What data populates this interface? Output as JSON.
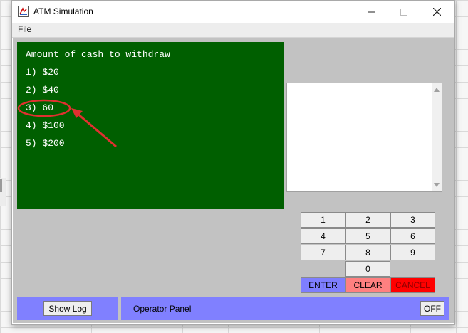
{
  "window": {
    "title": "ATM Simulation",
    "icon": "java-app-icon"
  },
  "window_controls": [
    "minimize-icon",
    "maximize-icon",
    "close-icon"
  ],
  "menu": {
    "file": "File"
  },
  "screen": {
    "lines": [
      "Amount of cash to withdraw",
      "1) $20",
      "2) $40",
      "3) 60",
      "4) $100",
      "5) $200"
    ]
  },
  "keypad": {
    "digits": [
      "1",
      "2",
      "3",
      "4",
      "5",
      "6",
      "7",
      "8",
      "9",
      "0"
    ],
    "enter": "ENTER",
    "clear": "CLEAR",
    "cancel": "CANCEL"
  },
  "log": {
    "show_log": "Show Log"
  },
  "operator_panel": {
    "label": "Operator Panel",
    "off": "OFF"
  },
  "colors": {
    "screen_bg": "#005f00",
    "panel_bg": "#c2c2c2",
    "operator_bg": "#8080ff",
    "enter_bg": "#7e7eff",
    "clear_bg": "#ff8080",
    "cancel_bg": "#ff0000",
    "annotation": "#e03030"
  }
}
